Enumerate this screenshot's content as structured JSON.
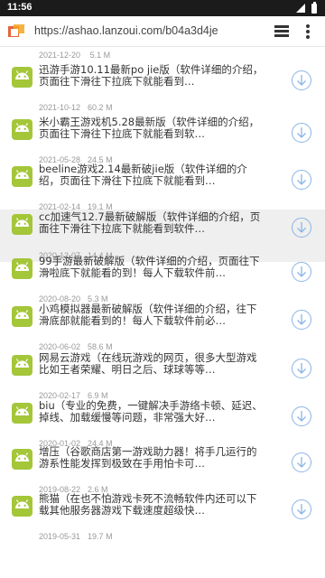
{
  "status_bar": {
    "time": "11:56"
  },
  "browser": {
    "url": "https://ashao.lanzoui.com/b04a3d4je"
  },
  "partial_top": {
    "date": "2021-12-20",
    "size": "5.1 M"
  },
  "items": [
    {
      "title": "迅游手游10.11最新po jie版（软件详细的介绍，页面往下滑往下拉底下就能看到…",
      "date": "2021-10-12",
      "size": "60.2 M"
    },
    {
      "title": "米小霸王游戏机5.28最新版（软件详细的介绍，页面往下滑往下拉底下就能看到软…",
      "date": "2021-05-28",
      "size": "24.5 M"
    },
    {
      "title": "beeline游戏2.14最新破jie版（软件详细的介绍，页面往下滑往下拉底下就能看到…",
      "date": "2021-02-14",
      "size": "19.1 M"
    },
    {
      "title": "cc加速气12.7最新破解版（软件详细的介绍，页面往下滑往下拉底下就能看到软件…",
      "date": "2020-12-07",
      "size": "14.4 M"
    },
    {
      "title": "99手游最新破解版（软件详细的介绍，页面往下滑啦底下就能看的到！每人下载软件前…",
      "date": "2020-08-20",
      "size": "5.3 M"
    },
    {
      "title": "小鸡模拟器最新破解版（软件详细的介绍，往下滑底部就能看到的！每人下载软件前必…",
      "date": "2020-06-02",
      "size": "58.6 M"
    },
    {
      "title": "网易云游戏（在线玩游戏的网页，很多大型游戏比如王者荣耀、明日之后、球球等等…",
      "date": "2020-02-17",
      "size": "6.9 M"
    },
    {
      "title": "biu（专业的免费，一键解决手游络卡顿、延迟、掉线、加载缓慢等问题，非常强大好…",
      "date": "2020-01-02",
      "size": "24.4 M"
    },
    {
      "title": "增压（谷歌商店第一游戏助力器！将手几运行的游系性能发挥到极致在手用怕卡可…",
      "date": "2019-08-22",
      "size": "2.6 M"
    },
    {
      "title": "熊猫（在也不怕游戏卡死不流畅软件内还可以下载其他服务器游戏下载速度超级快…",
      "date": "2019-05-31",
      "size": "19.7 M"
    }
  ]
}
